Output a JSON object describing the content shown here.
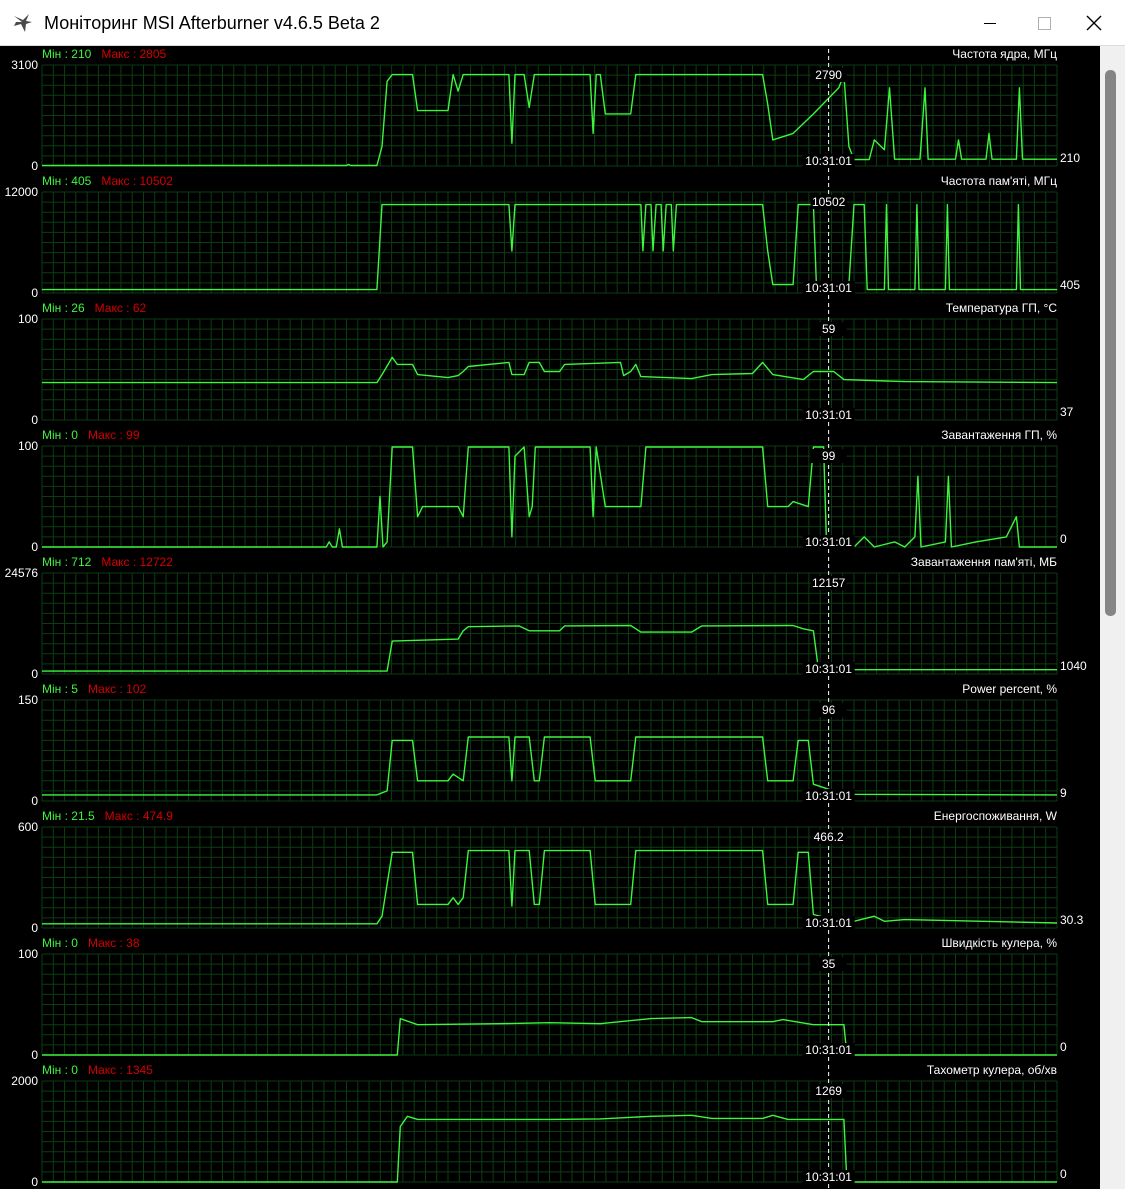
{
  "window": {
    "title": "Моніторинг MSI Afterburner v4.6.5 Beta 2",
    "icon": "afterburner-plane-icon"
  },
  "colors": {
    "graph_line": "#3df53d",
    "min_text": "#3df53d",
    "max_text": "#d40000",
    "grid": "#0b3d12",
    "label": "#ffffff",
    "cursor": "#ffffff"
  },
  "cursor": {
    "time_label": "10:31:01",
    "position_fraction": 0.775
  },
  "graphs": [
    {
      "id": "core-clock",
      "title": "Частота ядра, МГц",
      "min_label": "Мін : 210",
      "max_label": "Макс : 2805",
      "y_top": "3100",
      "y_bottom": "0",
      "ymax": 3100,
      "cursor_value": "2790",
      "current_value": "210",
      "points": [
        [
          0,
          15
        ],
        [
          30,
          15
        ],
        [
          30.2,
          50
        ],
        [
          30.4,
          15
        ],
        [
          33,
          15
        ],
        [
          33.5,
          600
        ],
        [
          34,
          2600
        ],
        [
          34.5,
          2805
        ],
        [
          36.5,
          2805
        ],
        [
          37,
          1700
        ],
        [
          40,
          1700
        ],
        [
          40.5,
          2805
        ],
        [
          41,
          2300
        ],
        [
          41.5,
          2805
        ],
        [
          46,
          2805
        ],
        [
          46.3,
          700
        ],
        [
          46.6,
          2805
        ],
        [
          47.5,
          2805
        ],
        [
          48,
          1800
        ],
        [
          48.5,
          2805
        ],
        [
          54,
          2805
        ],
        [
          54.3,
          1000
        ],
        [
          54.6,
          2805
        ],
        [
          55,
          2805
        ],
        [
          55.5,
          1600
        ],
        [
          58,
          1600
        ],
        [
          58.5,
          2805
        ],
        [
          71,
          2805
        ],
        [
          71.5,
          1900
        ],
        [
          72,
          800
        ],
        [
          74,
          1000
        ],
        [
          76,
          1600
        ],
        [
          78.5,
          2400
        ],
        [
          79,
          2805
        ],
        [
          79.5,
          600
        ],
        [
          80,
          200
        ],
        [
          81.5,
          200
        ],
        [
          82,
          800
        ],
        [
          83,
          500
        ],
        [
          83.5,
          2400
        ],
        [
          84,
          210
        ],
        [
          86.5,
          210
        ],
        [
          87,
          2400
        ],
        [
          87.3,
          210
        ],
        [
          90,
          210
        ],
        [
          90.3,
          800
        ],
        [
          90.6,
          210
        ],
        [
          93,
          210
        ],
        [
          93.3,
          1000
        ],
        [
          93.6,
          210
        ],
        [
          96,
          210
        ],
        [
          96.3,
          2400
        ],
        [
          96.6,
          210
        ],
        [
          100,
          210
        ]
      ]
    },
    {
      "id": "mem-clock",
      "title": "Частота пам'яті, МГц",
      "min_label": "Мін : 405",
      "max_label": "Макс : 10502",
      "y_top": "12000",
      "y_bottom": "0",
      "ymax": 12000,
      "cursor_value": "10502",
      "current_value": "405",
      "points": [
        [
          0,
          405
        ],
        [
          33,
          405
        ],
        [
          33.5,
          10502
        ],
        [
          46,
          10502
        ],
        [
          46.3,
          5000
        ],
        [
          46.6,
          10502
        ],
        [
          59,
          10502
        ],
        [
          59.2,
          5000
        ],
        [
          59.5,
          10502
        ],
        [
          60,
          10502
        ],
        [
          60.2,
          5000
        ],
        [
          60.5,
          10502
        ],
        [
          61,
          10502
        ],
        [
          61.2,
          5000
        ],
        [
          61.5,
          10502
        ],
        [
          62,
          10502
        ],
        [
          62.2,
          5000
        ],
        [
          62.5,
          10502
        ],
        [
          71,
          10502
        ],
        [
          71.5,
          5000
        ],
        [
          72,
          1000
        ],
        [
          74,
          1000
        ],
        [
          74.5,
          10502
        ],
        [
          76,
          10502
        ],
        [
          76.3,
          1000
        ],
        [
          79.5,
          1000
        ],
        [
          80,
          10502
        ],
        [
          81,
          10502
        ],
        [
          81.3,
          405
        ],
        [
          83,
          405
        ],
        [
          83.2,
          10502
        ],
        [
          83.4,
          405
        ],
        [
          86,
          405
        ],
        [
          86.2,
          10502
        ],
        [
          86.4,
          405
        ],
        [
          89,
          405
        ],
        [
          89.2,
          10502
        ],
        [
          89.4,
          405
        ],
        [
          96,
          405
        ],
        [
          96.2,
          10502
        ],
        [
          96.4,
          405
        ],
        [
          100,
          405
        ]
      ]
    },
    {
      "id": "gpu-temp",
      "title": "Температура ГП, °C",
      "min_label": "Мін : 26",
      "max_label": "Макс : 62",
      "y_top": "100",
      "y_bottom": "0",
      "ymax": 100,
      "cursor_value": "59",
      "current_value": "37",
      "points": [
        [
          0,
          37
        ],
        [
          33,
          37
        ],
        [
          33.5,
          45
        ],
        [
          34.5,
          62
        ],
        [
          35,
          55
        ],
        [
          36.5,
          55
        ],
        [
          37,
          45
        ],
        [
          40,
          42
        ],
        [
          41,
          44
        ],
        [
          41.5,
          48
        ],
        [
          42,
          53
        ],
        [
          45,
          56
        ],
        [
          46,
          57
        ],
        [
          46.3,
          45
        ],
        [
          47.5,
          45
        ],
        [
          48,
          57
        ],
        [
          49,
          57
        ],
        [
          49.5,
          48
        ],
        [
          51,
          48
        ],
        [
          51.5,
          55
        ],
        [
          57,
          57
        ],
        [
          57.3,
          44
        ],
        [
          58,
          48
        ],
        [
          58.5,
          55
        ],
        [
          59,
          43
        ],
        [
          64,
          41
        ],
        [
          66,
          45
        ],
        [
          70,
          46
        ],
        [
          71,
          57
        ],
        [
          72,
          45
        ],
        [
          75,
          40
        ],
        [
          76,
          48
        ],
        [
          78,
          48
        ],
        [
          79,
          40
        ],
        [
          85,
          38
        ],
        [
          100,
          37
        ]
      ]
    },
    {
      "id": "gpu-load",
      "title": "Завантаження ГП, %",
      "min_label": "Мін : 0",
      "max_label": "Макс : 99",
      "y_top": "100",
      "y_bottom": "0",
      "ymax": 100,
      "cursor_value": "99",
      "current_value": "0",
      "points": [
        [
          0,
          0
        ],
        [
          28,
          0
        ],
        [
          28.3,
          5
        ],
        [
          28.6,
          0
        ],
        [
          29,
          0
        ],
        [
          29.3,
          18
        ],
        [
          29.6,
          0
        ],
        [
          33,
          0
        ],
        [
          33.3,
          50
        ],
        [
          33.6,
          0
        ],
        [
          34,
          5
        ],
        [
          34.5,
          99
        ],
        [
          36.5,
          99
        ],
        [
          37,
          30
        ],
        [
          37.5,
          40
        ],
        [
          41,
          40
        ],
        [
          41.5,
          30
        ],
        [
          42,
          99
        ],
        [
          46,
          99
        ],
        [
          46.3,
          10
        ],
        [
          46.6,
          90
        ],
        [
          47.5,
          99
        ],
        [
          48,
          30
        ],
        [
          48.3,
          40
        ],
        [
          48.6,
          99
        ],
        [
          54,
          99
        ],
        [
          54.3,
          30
        ],
        [
          54.6,
          99
        ],
        [
          55.5,
          40
        ],
        [
          59,
          40
        ],
        [
          59.5,
          99
        ],
        [
          71,
          99
        ],
        [
          71.5,
          40
        ],
        [
          72,
          40
        ],
        [
          73.5,
          40
        ],
        [
          74,
          45
        ],
        [
          75.5,
          40
        ],
        [
          76,
          99
        ],
        [
          77,
          99
        ],
        [
          77.3,
          0
        ],
        [
          79.5,
          5
        ],
        [
          80,
          0
        ],
        [
          81,
          10
        ],
        [
          82,
          0
        ],
        [
          84,
          5
        ],
        [
          85,
          0
        ],
        [
          86,
          10
        ],
        [
          86.3,
          70
        ],
        [
          86.6,
          0
        ],
        [
          89,
          5
        ],
        [
          89.3,
          70
        ],
        [
          89.6,
          0
        ],
        [
          92,
          5
        ],
        [
          95,
          10
        ],
        [
          96,
          30
        ],
        [
          96.3,
          0
        ],
        [
          100,
          0
        ]
      ]
    },
    {
      "id": "mem-usage",
      "title": "Завантаження пам'яті, МБ",
      "min_label": "Мін : 712",
      "max_label": "Макс : 12722",
      "y_top": "24576",
      "y_bottom": "0",
      "ymax": 24576,
      "cursor_value": "12157",
      "current_value": "1040",
      "points": [
        [
          0,
          712
        ],
        [
          34,
          712
        ],
        [
          34.5,
          8000
        ],
        [
          41,
          8500
        ],
        [
          41.5,
          10500
        ],
        [
          42,
          11500
        ],
        [
          47,
          11700
        ],
        [
          48,
          10500
        ],
        [
          51,
          10500
        ],
        [
          51.5,
          11700
        ],
        [
          58,
          11800
        ],
        [
          59,
          10200
        ],
        [
          64,
          10200
        ],
        [
          65,
          11700
        ],
        [
          74,
          11800
        ],
        [
          75,
          11000
        ],
        [
          76,
          10500
        ],
        [
          76.5,
          1040
        ],
        [
          100,
          1040
        ]
      ]
    },
    {
      "id": "power-percent",
      "title": "Power percent, %",
      "min_label": "Мін : 5",
      "max_label": "Макс : 102",
      "y_top": "150",
      "y_bottom": "0",
      "ymax": 150,
      "cursor_value": "96",
      "current_value": "9",
      "points": [
        [
          0,
          9
        ],
        [
          33,
          9
        ],
        [
          34,
          15
        ],
        [
          34.5,
          90
        ],
        [
          36.5,
          90
        ],
        [
          37,
          30
        ],
        [
          40,
          30
        ],
        [
          40.5,
          40
        ],
        [
          41.5,
          30
        ],
        [
          42,
          95
        ],
        [
          46,
          95
        ],
        [
          46.3,
          30
        ],
        [
          46.6,
          95
        ],
        [
          48,
          95
        ],
        [
          48.5,
          30
        ],
        [
          49,
          30
        ],
        [
          49.5,
          95
        ],
        [
          54,
          95
        ],
        [
          54.5,
          30
        ],
        [
          55,
          30
        ],
        [
          58,
          30
        ],
        [
          58.5,
          95
        ],
        [
          71,
          95
        ],
        [
          71.5,
          30
        ],
        [
          74,
          30
        ],
        [
          74.5,
          90
        ],
        [
          75.5,
          90
        ],
        [
          76,
          25
        ],
        [
          78,
          15
        ],
        [
          80,
          10
        ],
        [
          100,
          9
        ]
      ]
    },
    {
      "id": "power-draw",
      "title": "Енергоспоживання, W",
      "min_label": "Мін : 21.5",
      "max_label": "Макс : 474.9",
      "y_top": "600",
      "y_bottom": "0",
      "ymax": 600,
      "cursor_value": "466.2",
      "current_value": "30.3",
      "points": [
        [
          0,
          25
        ],
        [
          33,
          25
        ],
        [
          33.5,
          70
        ],
        [
          34.5,
          450
        ],
        [
          36.5,
          450
        ],
        [
          37,
          140
        ],
        [
          40,
          140
        ],
        [
          40.5,
          180
        ],
        [
          41,
          140
        ],
        [
          41.5,
          180
        ],
        [
          42,
          460
        ],
        [
          46,
          460
        ],
        [
          46.3,
          130
        ],
        [
          46.6,
          460
        ],
        [
          48,
          460
        ],
        [
          48.5,
          140
        ],
        [
          49,
          140
        ],
        [
          49.5,
          460
        ],
        [
          54,
          460
        ],
        [
          54.5,
          140
        ],
        [
          55,
          140
        ],
        [
          58,
          140
        ],
        [
          58.5,
          460
        ],
        [
          71,
          460
        ],
        [
          71.5,
          140
        ],
        [
          74,
          140
        ],
        [
          74.5,
          450
        ],
        [
          75.5,
          450
        ],
        [
          76,
          80
        ],
        [
          78,
          50
        ],
        [
          80,
          40
        ],
        [
          82,
          70
        ],
        [
          83,
          40
        ],
        [
          85,
          50
        ],
        [
          100,
          30
        ]
      ]
    },
    {
      "id": "fan-speed",
      "title": "Швидкість кулера, %",
      "min_label": "Мін : 0",
      "max_label": "Макс : 38",
      "y_top": "100",
      "y_bottom": "0",
      "ymax": 100,
      "cursor_value": "35",
      "current_value": "0",
      "points": [
        [
          0,
          0
        ],
        [
          35,
          0
        ],
        [
          35.3,
          36
        ],
        [
          37,
          30
        ],
        [
          45,
          31
        ],
        [
          50,
          32
        ],
        [
          55,
          31
        ],
        [
          60,
          36
        ],
        [
          64,
          37
        ],
        [
          65,
          33
        ],
        [
          72,
          33
        ],
        [
          73,
          35
        ],
        [
          76,
          30
        ],
        [
          79,
          30
        ],
        [
          79.3,
          0
        ],
        [
          100,
          0
        ]
      ]
    },
    {
      "id": "fan-tach",
      "title": "Тахометр кулера, об/хв",
      "min_label": "Мін : 0",
      "max_label": "Макс : 1345",
      "y_top": "2000",
      "y_bottom": "0",
      "ymax": 2000,
      "cursor_value": "1269",
      "current_value": "0",
      "points": [
        [
          0,
          0
        ],
        [
          35,
          0
        ],
        [
          35.3,
          1100
        ],
        [
          36,
          1300
        ],
        [
          37,
          1240
        ],
        [
          45,
          1240
        ],
        [
          50,
          1240
        ],
        [
          55,
          1250
        ],
        [
          60,
          1300
        ],
        [
          64,
          1320
        ],
        [
          66,
          1260
        ],
        [
          71,
          1260
        ],
        [
          72,
          1320
        ],
        [
          73.5,
          1240
        ],
        [
          79,
          1240
        ],
        [
          79.3,
          0
        ],
        [
          100,
          0
        ]
      ]
    }
  ]
}
